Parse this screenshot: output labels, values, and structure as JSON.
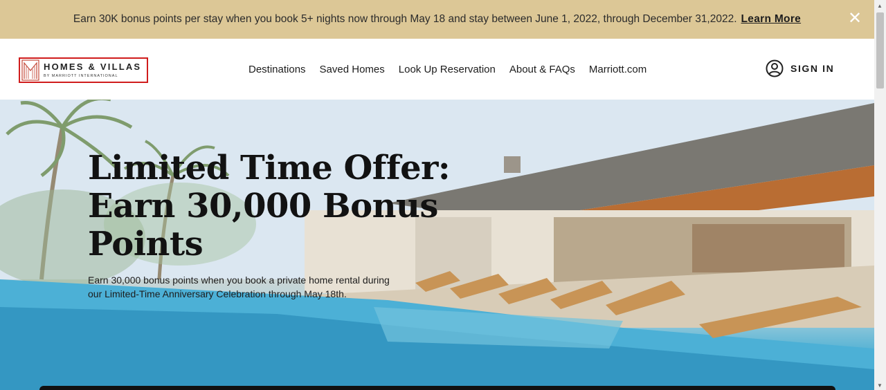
{
  "promo": {
    "text": "Earn 30K bonus points per stay when you book 5+ nights now through May 18 and stay between June 1, 2022, through December 31,2022.",
    "link": "Learn More",
    "close_glyph": "✕"
  },
  "header": {
    "logo_main": "HOMES & VILLAS",
    "logo_sub": "BY MARRIOTT INTERNATIONAL",
    "nav": [
      "Destinations",
      "Saved Homes",
      "Look Up Reservation",
      "About & FAQs",
      "Marriott.com"
    ],
    "signin": "SIGN IN"
  },
  "hero": {
    "title_lines": [
      "Limited Time Offer:",
      "Earn 30,000 Bonus",
      "Points"
    ],
    "description": "Earn 30,000 bonus points when you book a private home rental during our Limited-Time Anniversary Celebration through May 18th."
  },
  "colors": {
    "banner": "#dcc796",
    "logo_border": "#d01c1c",
    "logo_accent": "#c44a3a"
  }
}
